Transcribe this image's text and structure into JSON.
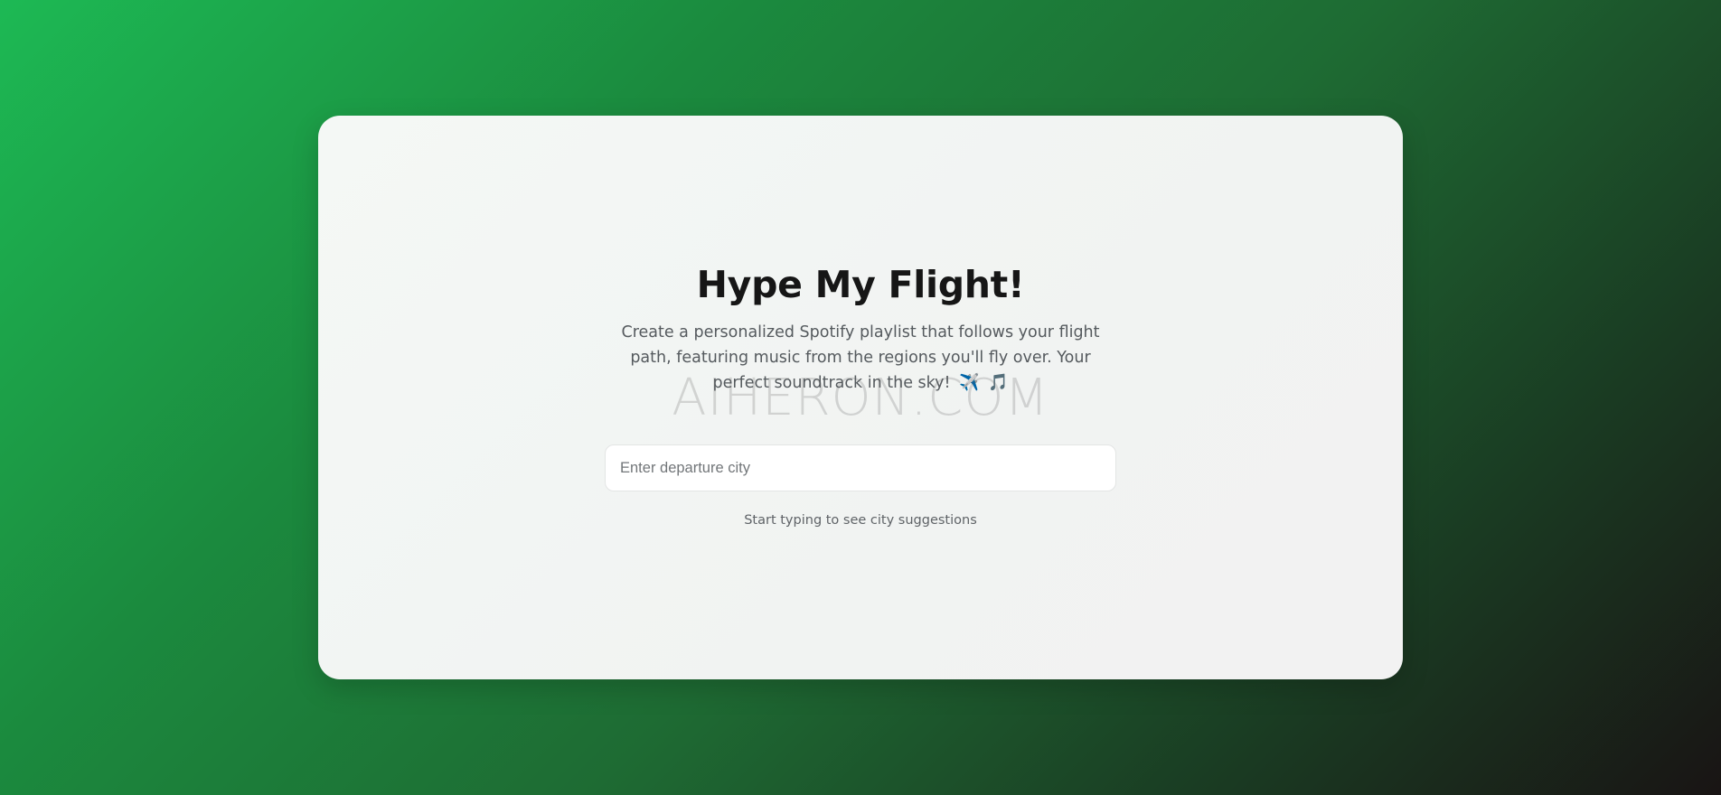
{
  "header": {
    "title": "Hype My Flight!"
  },
  "intro": {
    "description": "Create a personalized Spotify playlist that follows your flight path, featuring music from the regions you'll fly over. Your perfect soundtrack in the sky!",
    "icons": [
      "airplane-icon",
      "music-notes-icon"
    ],
    "plane_glyph": "✈️",
    "music_glyph": "🎵"
  },
  "search": {
    "placeholder": "Enter departure city",
    "value": ""
  },
  "hint": {
    "text": "Start typing to see city suggestions"
  },
  "watermark": {
    "text": "AIHERON.COM"
  },
  "colors": {
    "brand_green": "#1db954",
    "dark": "#191414"
  }
}
